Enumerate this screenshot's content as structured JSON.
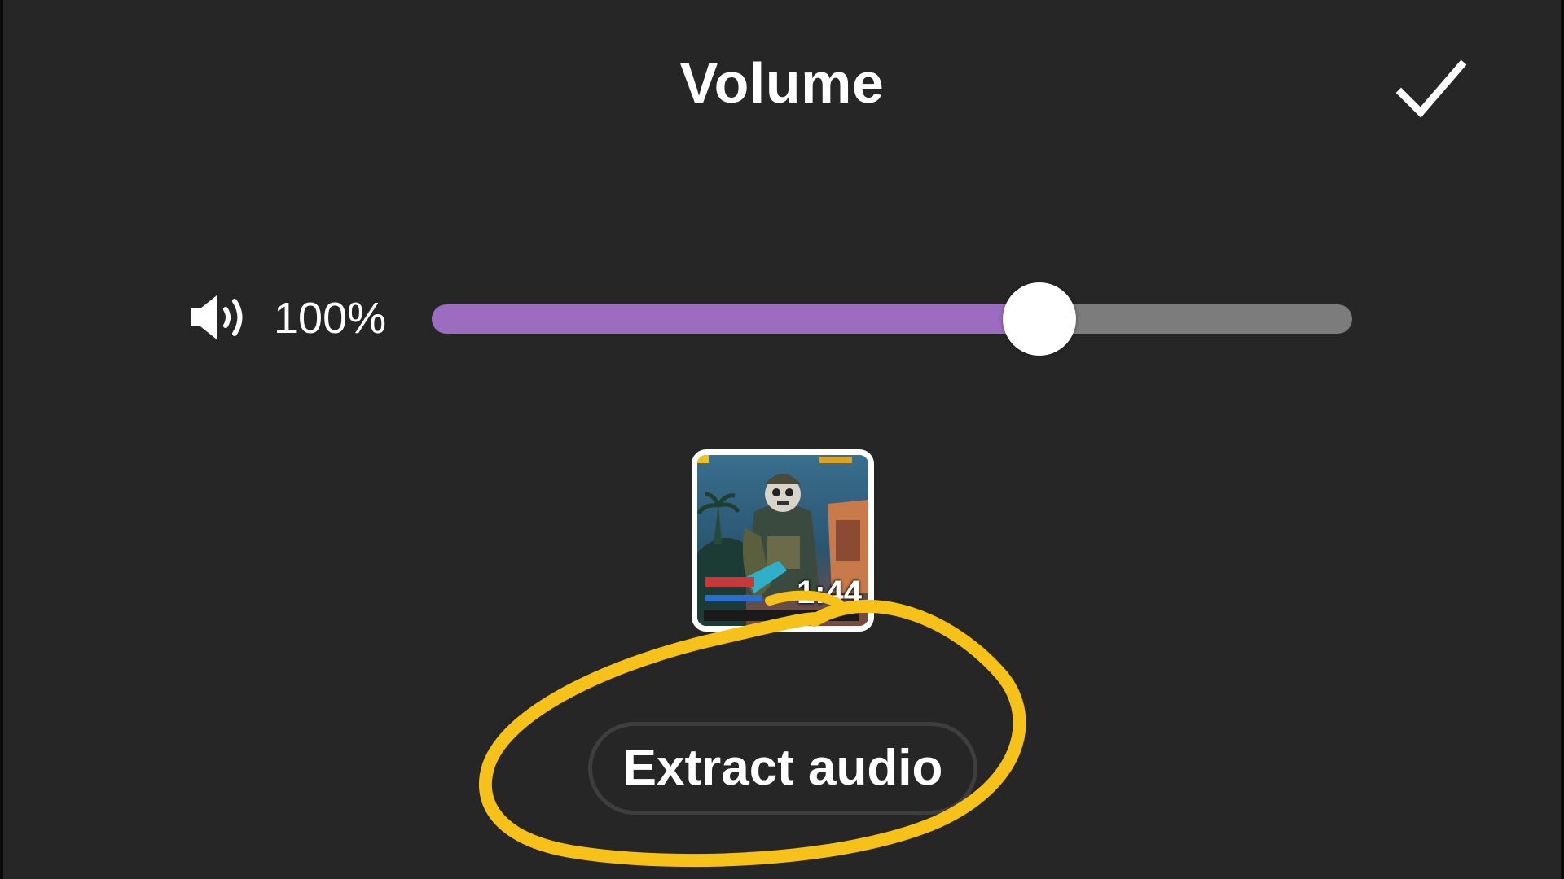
{
  "header": {
    "title": "Volume",
    "confirm_icon": "checkmark-icon"
  },
  "volume": {
    "icon": "speaker-icon",
    "label": "100%",
    "slider_fraction": 0.66,
    "fill_color": "#9b6cc0",
    "track_color": "#7c7c7c"
  },
  "clip": {
    "duration": "1:44"
  },
  "actions": {
    "extract_audio_label": "Extract audio"
  },
  "annotation": {
    "color": "#f6c21a",
    "shape": "hand-drawn circle around Extract audio"
  }
}
